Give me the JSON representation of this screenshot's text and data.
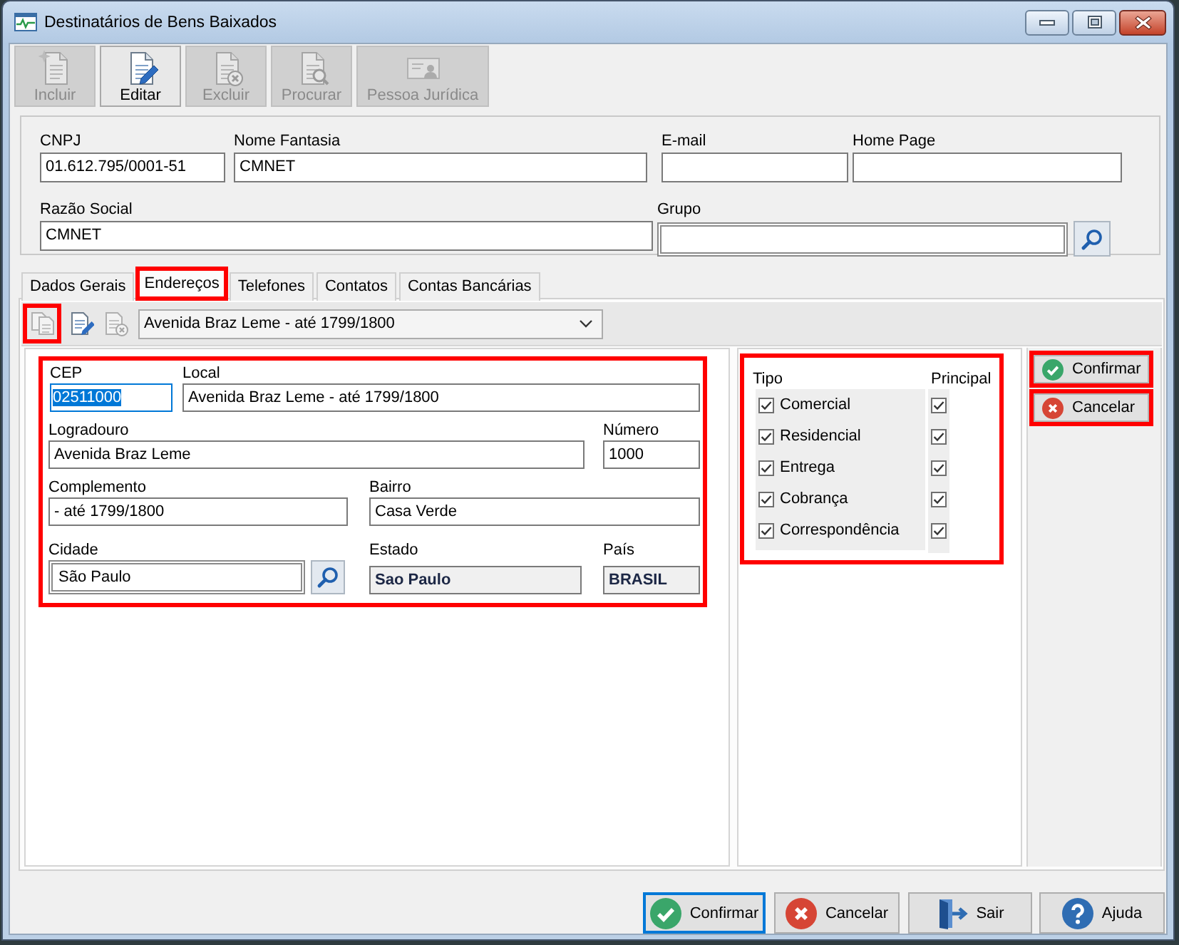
{
  "window": {
    "title": "Destinatários de Bens Baixados"
  },
  "toolbar": [
    {
      "label": "Incluir",
      "disabled": true
    },
    {
      "label": "Editar",
      "disabled": false
    },
    {
      "label": "Excluir",
      "disabled": true
    },
    {
      "label": "Procurar",
      "disabled": true
    },
    {
      "label": "Pessoa Jurídica",
      "disabled": true
    }
  ],
  "header": {
    "fields": [
      {
        "label": "CNPJ",
        "value": "01.612.795/0001-51",
        "kind": "text"
      },
      {
        "label": "Nome Fantasia",
        "value": "CMNET",
        "kind": "text"
      },
      {
        "label": "E-mail",
        "kind": "text"
      },
      {
        "label": "Home Page",
        "kind": "text"
      },
      {
        "label": "Razão Social",
        "value": "CMNET",
        "kind": "text"
      },
      {
        "label": "Grupo",
        "kind": "lookup"
      }
    ]
  },
  "tabs": [
    {
      "label": "Dados Gerais",
      "selected": false,
      "highlighted": false
    },
    {
      "label": "Endereços",
      "selected": true,
      "highlighted": true
    },
    {
      "label": "Telefones",
      "selected": false,
      "highlighted": false
    },
    {
      "label": "Contatos",
      "selected": false,
      "highlighted": false
    },
    {
      "label": "Contas Bancárias",
      "selected": false,
      "highlighted": false
    }
  ],
  "address_bar": {
    "buttons": [
      {
        "disabled": true,
        "highlighted": true
      },
      {
        "disabled": false,
        "highlighted": false
      },
      {
        "disabled": true,
        "highlighted": false
      }
    ],
    "selected_address": "Avenida Braz Leme - até 1799/1800"
  },
  "address": {
    "highlighted": true,
    "fields": [
      {
        "label": "CEP",
        "value": "02511000",
        "kind": "text",
        "readonly": false,
        "focused": true
      },
      {
        "label": "Local",
        "value": "Avenida Braz Leme - até 1799/1800",
        "kind": "text",
        "readonly": false,
        "focused": false
      },
      {
        "label": "Logradouro",
        "value": "Avenida Braz Leme",
        "kind": "text",
        "readonly": false,
        "focused": false
      },
      {
        "label": "Número",
        "value": "1000",
        "kind": "text",
        "readonly": false,
        "focused": false
      },
      {
        "label": "Complemento",
        "value": "- até 1799/1800",
        "kind": "text",
        "readonly": false,
        "focused": false
      },
      {
        "label": "Bairro",
        "value": "Casa Verde",
        "kind": "text",
        "readonly": false,
        "focused": false
      },
      {
        "label": "Cidade",
        "value": "São Paulo",
        "kind": "lookup",
        "readonly": false,
        "focused": false
      },
      {
        "label": "Estado",
        "value": "Sao Paulo",
        "kind": "text",
        "readonly": true,
        "focused": false
      },
      {
        "label": "País",
        "value": "BRASIL",
        "kind": "text",
        "readonly": true,
        "focused": false
      }
    ]
  },
  "types": {
    "highlighted": true,
    "type_header": "Tipo",
    "principal_header": "Principal",
    "rows": [
      {
        "label": "Comercial",
        "checked": true,
        "principal": true
      },
      {
        "label": "Residencial",
        "checked": true,
        "principal": true
      },
      {
        "label": "Entrega",
        "checked": true,
        "principal": true
      },
      {
        "label": "Cobrança",
        "checked": true,
        "principal": true
      },
      {
        "label": "Correspondência",
        "checked": true,
        "principal": true
      }
    ]
  },
  "side_buttons": [
    {
      "label": "Confirmar",
      "kind": "confirm",
      "highlighted": true
    },
    {
      "label": "Cancelar",
      "kind": "cancel",
      "highlighted": true
    }
  ],
  "footer_buttons": [
    {
      "label": "Confirmar",
      "kind": "confirm",
      "focused": true
    },
    {
      "label": "Cancelar",
      "kind": "cancel",
      "focused": false
    },
    {
      "label": "Sair",
      "kind": "exit",
      "focused": false
    },
    {
      "label": "Ajuda",
      "kind": "help",
      "focused": false
    }
  ]
}
